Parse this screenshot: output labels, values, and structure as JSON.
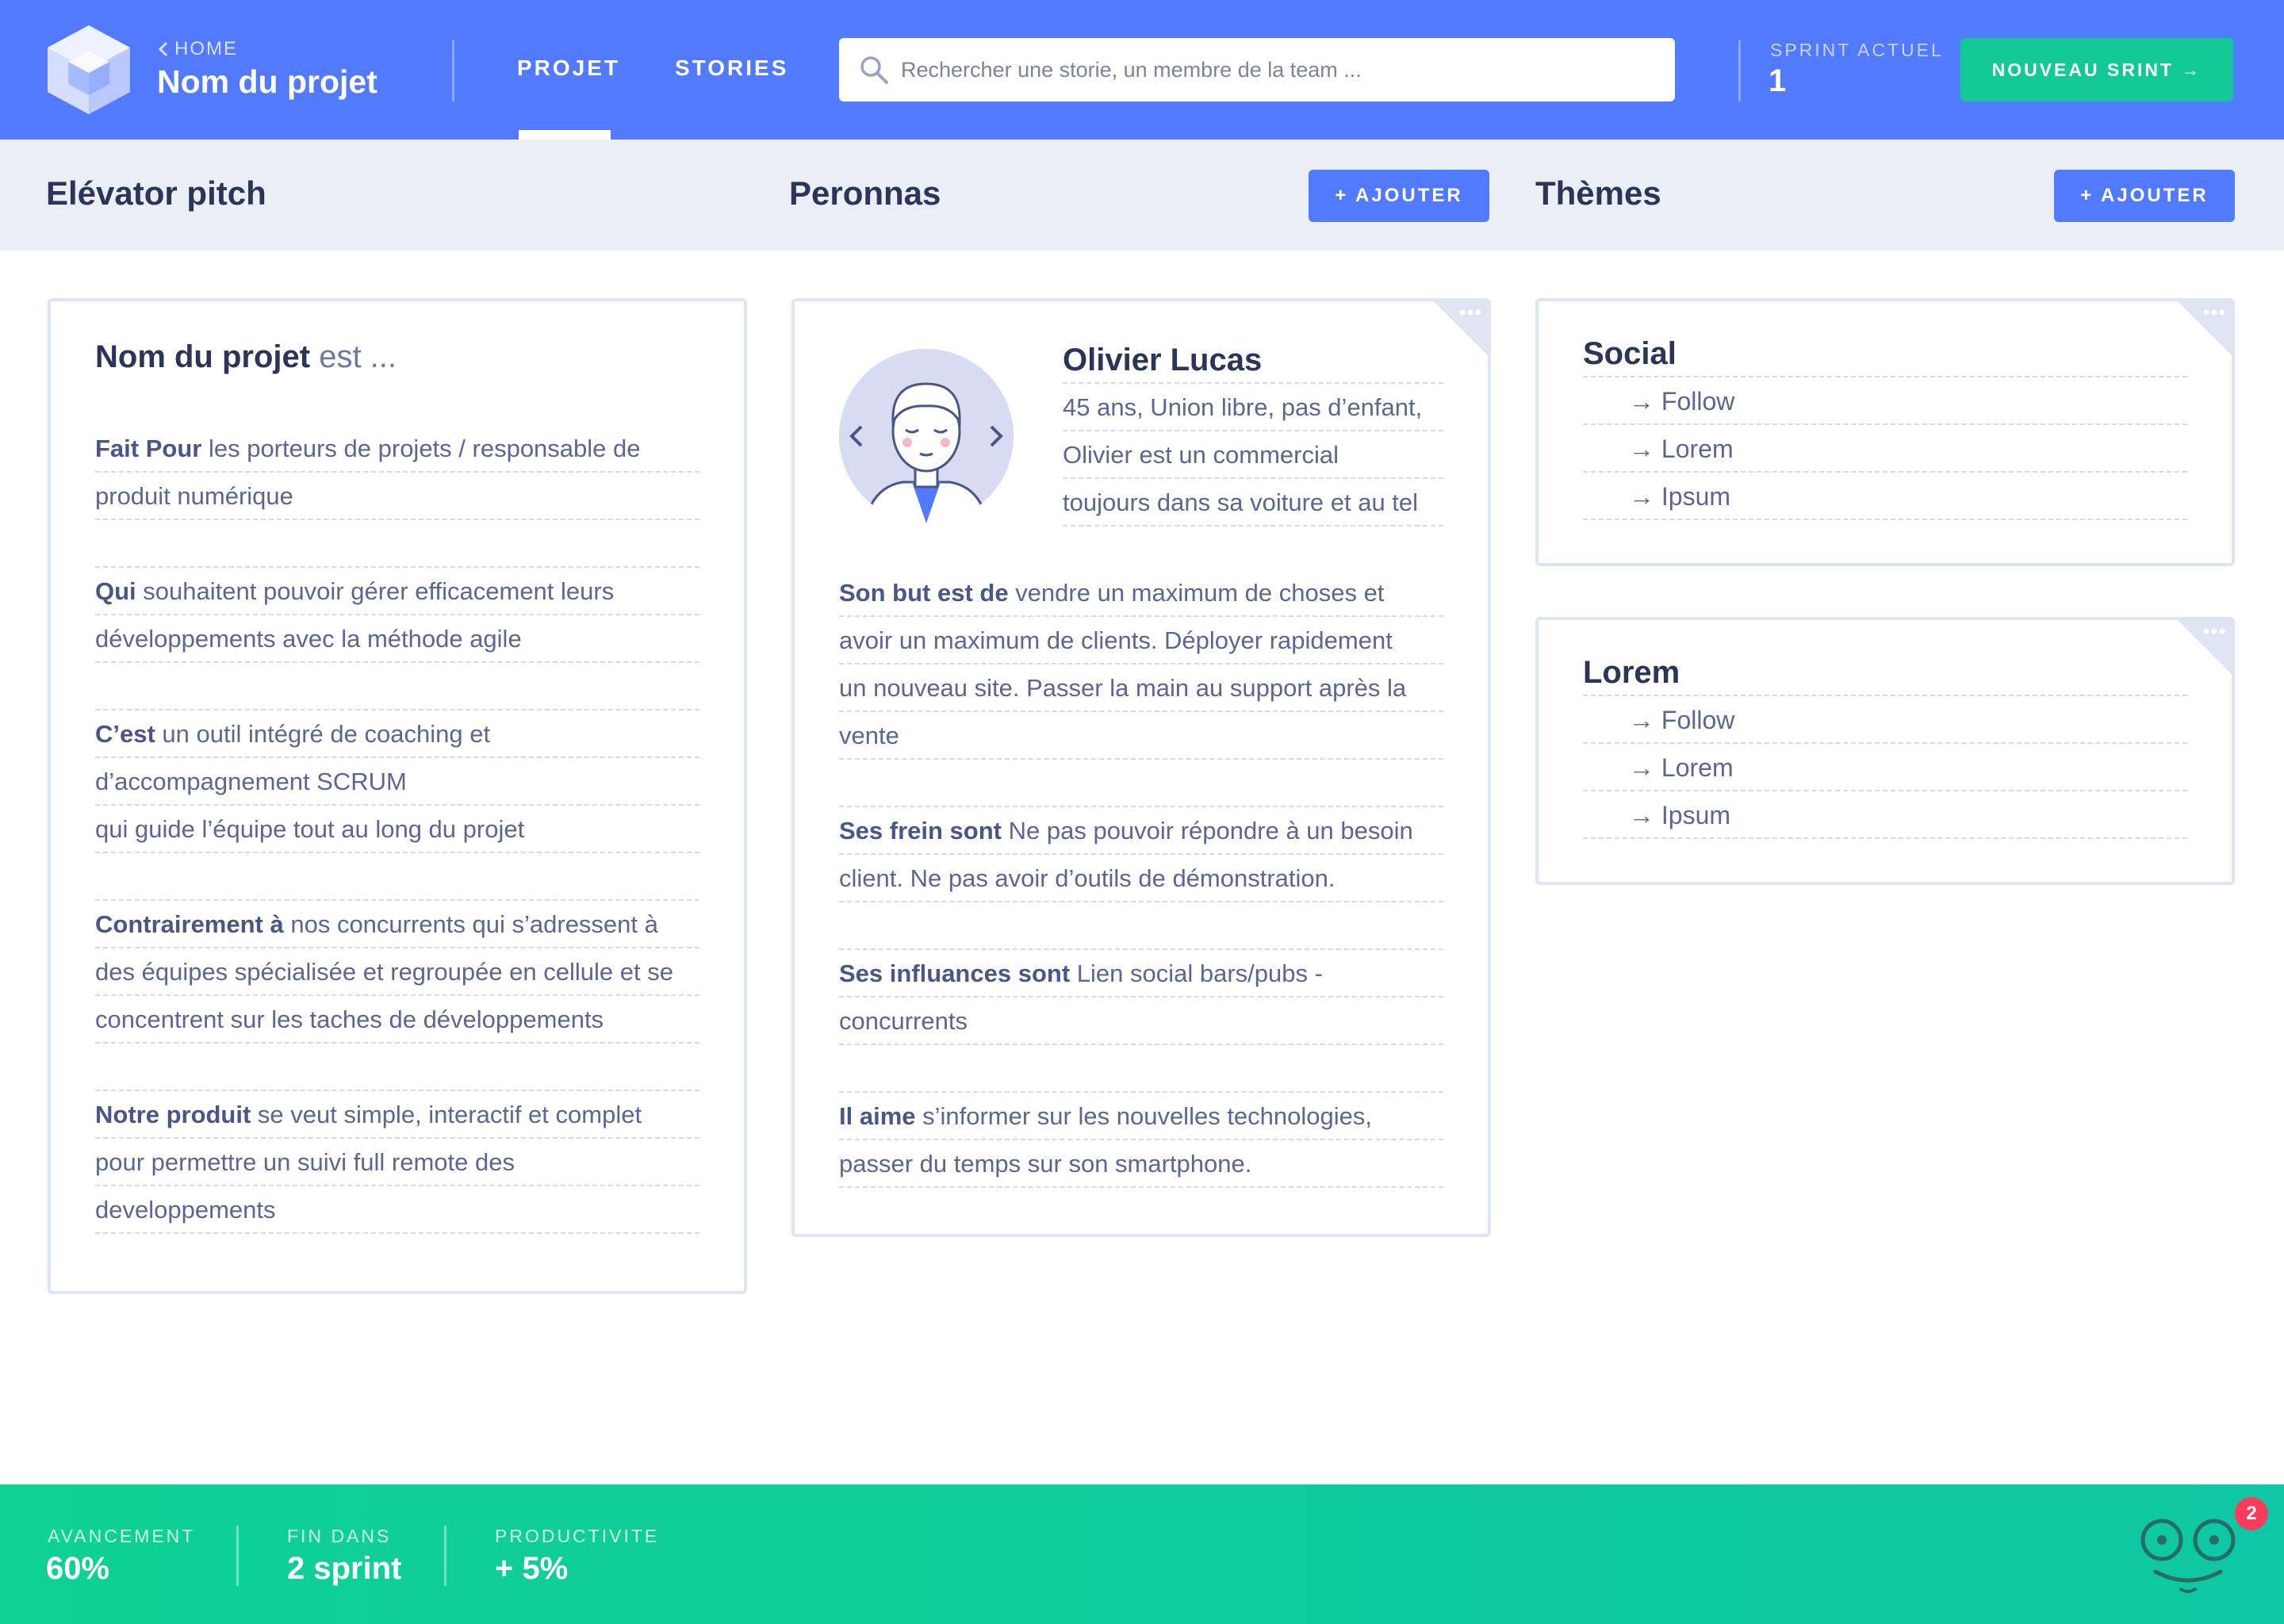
{
  "header": {
    "home_label": "HOME",
    "project_name": "Nom du projet",
    "tabs": [
      {
        "label": "PROJET",
        "active": true
      },
      {
        "label": "STORIES",
        "active": false
      }
    ],
    "search_placeholder": "Rechercher une storie, un membre de la team ...",
    "sprint_label": "SPRINT ACTUEL",
    "sprint_value": "1",
    "new_sprint_label": "NOUVEAU SRINT →"
  },
  "sections": {
    "pitch_title": "Elévator pitch",
    "personas_title": "Peronnas",
    "themes_title": "Thèmes",
    "add_label": "+ AJOUTER"
  },
  "pitch": {
    "heading_bold": "Nom du projet",
    "heading_light": " est ...",
    "lines": [
      {
        "bold": "Fait Pour",
        "text": " les porteurs de projets / responsable de"
      },
      {
        "bold": "",
        "text": "produit numérique"
      },
      {
        "bold": "",
        "text": ""
      },
      {
        "bold": "Qui",
        "text": " souhaitent pouvoir gérer efficacement leurs"
      },
      {
        "bold": "",
        "text": "développements avec la méthode agile"
      },
      {
        "bold": "",
        "text": ""
      },
      {
        "bold": "C’est",
        "text": "  un outil intégré de coaching et"
      },
      {
        "bold": "",
        "text": "d’accompagnement SCRUM"
      },
      {
        "bold": "",
        "text": "qui guide l’équipe tout au long du projet"
      },
      {
        "bold": "",
        "text": ""
      },
      {
        "bold": "Contrairement à",
        "text": " nos concurrents qui s’adressent à"
      },
      {
        "bold": "",
        "text": "des équipes spécialisée et regroupée en cellule et se"
      },
      {
        "bold": "",
        "text": "concentrent sur les taches de développements"
      },
      {
        "bold": "",
        "text": ""
      },
      {
        "bold": "Notre produit",
        "text": "  se veut simple, interactif et complet"
      },
      {
        "bold": "",
        "text": "pour permettre un suivi full remote des"
      },
      {
        "bold": "",
        "text": "developpements"
      }
    ]
  },
  "persona": {
    "name": "Olivier Lucas",
    "intro": [
      "45 ans, Union libre, pas d’enfant,",
      "Olivier est un commercial",
      "toujours dans sa voiture  et au tel"
    ],
    "lines": [
      {
        "bold": "Son but est de",
        "text": " vendre un maximum de choses et"
      },
      {
        "bold": "",
        "text": "avoir un maximum de clients. Déployer rapidement"
      },
      {
        "bold": "",
        "text": "un nouveau site. Passer la main au support après la"
      },
      {
        "bold": "",
        "text": "vente"
      },
      {
        "bold": "",
        "text": ""
      },
      {
        "bold": "Ses frein sont",
        "text": " Ne pas pouvoir répondre à un besoin"
      },
      {
        "bold": "",
        "text": "client. Ne pas avoir d’outils de démonstration."
      },
      {
        "bold": "",
        "text": ""
      },
      {
        "bold": "Ses influances sont",
        "text": " Lien social bars/pubs -"
      },
      {
        "bold": "",
        "text": "concurrents"
      },
      {
        "bold": "",
        "text": ""
      },
      {
        "bold": "Il aime",
        "text": " s’informer sur  les nouvelles technologies,"
      },
      {
        "bold": "",
        "text": "passer du temps sur son smartphone."
      }
    ]
  },
  "themes": [
    {
      "title": "Social",
      "items": [
        "→ Follow",
        "→ Lorem",
        "→ Ipsum"
      ]
    },
    {
      "title": "Lorem",
      "items": [
        "→ Follow",
        "→ Lorem",
        "→ Ipsum"
      ]
    }
  ],
  "footer": {
    "stats": [
      {
        "label": "AVANCEMENT",
        "value": "60%"
      },
      {
        "label": "FIN DANS",
        "value": "2 sprint"
      },
      {
        "label": "PRODUCTIVITE",
        "value": "+ 5%"
      }
    ],
    "notification_count": "2"
  },
  "colors": {
    "primary": "#517aff",
    "accent": "#12c995",
    "text_dark": "#2a3558",
    "text_body": "#5b6691",
    "notification": "#ff3b5c"
  },
  "icons": [
    "logo-cube-icon",
    "chevron-left-icon",
    "search-icon",
    "more-dots-icon",
    "mascot-icon"
  ]
}
